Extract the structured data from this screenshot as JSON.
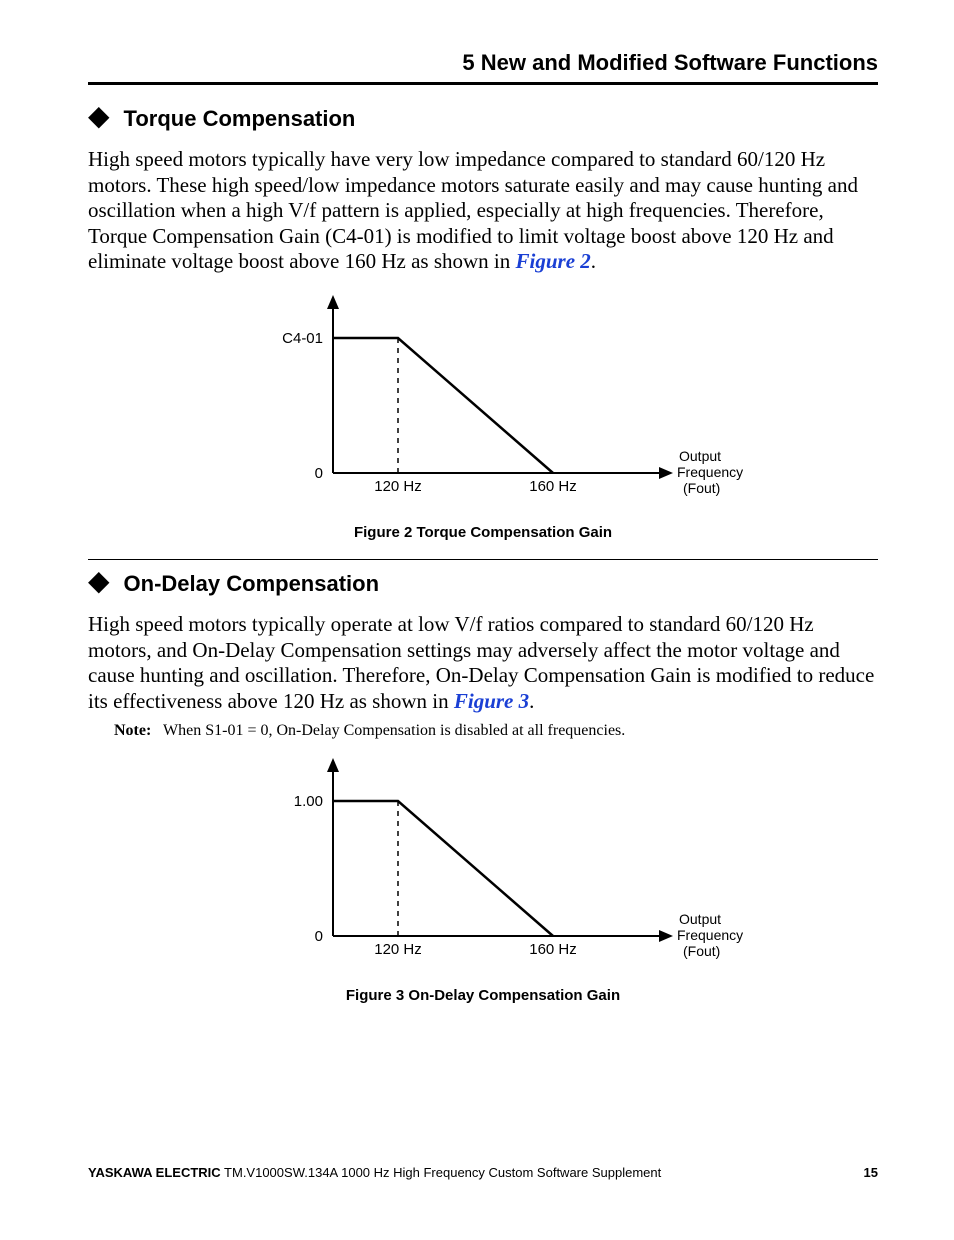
{
  "running_head": "5  New and Modified Software Functions",
  "section1": {
    "title": "Torque Compensation",
    "paragraph_pre": "High speed motors typically have very low impedance compared to standard 60/120 Hz motors. These high speed/low impedance motors saturate easily and may cause hunting and oscillation when a high V/f pattern is applied, especially at high frequencies. Therefore, Torque Compensation Gain (C4-01) is modified to limit voltage boost above 120 Hz and eliminate voltage boost above 160 Hz as shown in ",
    "paragraph_ref": "Figure 2",
    "paragraph_post": ".",
    "figure_caption": "Figure 2  Torque Compensation Gain"
  },
  "section2": {
    "title": "On-Delay Compensation",
    "paragraph_pre": "High speed motors typically operate at low V/f ratios compared to standard 60/120 Hz motors, and On-Delay Compensation settings may adversely affect the motor voltage and cause hunting and oscillation. Therefore, On-Delay Compensation Gain is modified to reduce its effectiveness above 120 Hz as shown in ",
    "paragraph_ref": "Figure 3",
    "paragraph_post": ".",
    "note_label": "Note:",
    "note_text": "When S1-01 = 0, On-Delay Compensation is disabled at all frequencies.",
    "figure_caption": "Figure 3  On-Delay Compensation Gain"
  },
  "chart_data": [
    {
      "type": "line",
      "title": "Torque Compensation Gain",
      "y_label_at_top": "C4-01",
      "origin_label": "0",
      "x_ticks": [
        "120 Hz",
        "160 Hz"
      ],
      "x_axis_end_label": "Output\nFrequency\n(Fout)",
      "points": [
        {
          "x": 0,
          "y": 1.0
        },
        {
          "x": 120,
          "y": 1.0
        },
        {
          "x": 160,
          "y": 0.0
        }
      ]
    },
    {
      "type": "line",
      "title": "On-Delay Compensation Gain",
      "y_label_at_top": "1.00",
      "origin_label": "0",
      "x_ticks": [
        "120 Hz",
        "160 Hz"
      ],
      "x_axis_end_label": "Output\nFrequency\n(Fout)",
      "points": [
        {
          "x": 0,
          "y": 1.0
        },
        {
          "x": 120,
          "y": 1.0
        },
        {
          "x": 160,
          "y": 0.0
        }
      ]
    }
  ],
  "footer": {
    "brand": "YASKAWA ELECTRIC",
    "doc": " TM.V1000SW.134A 1000 Hz High Frequency Custom Software Supplement",
    "page": "15"
  }
}
